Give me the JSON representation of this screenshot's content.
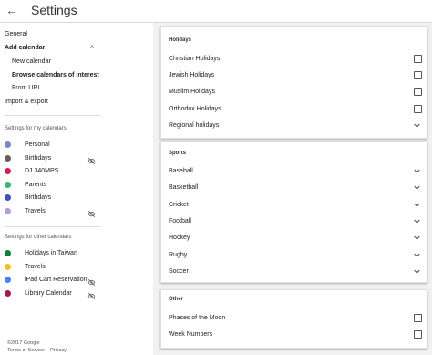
{
  "header": {
    "title": "Settings",
    "back_icon": "arrow-left-icon"
  },
  "sidebar": {
    "general": "General",
    "add_calendar": "Add calendar",
    "new_calendar": "New calendar",
    "browse": "Browse calendars of interest",
    "from_url": "From URL",
    "import_export": "Import & export",
    "my_calendars_label": "Settings for my calendars",
    "my_calendars": [
      {
        "name": "Personal",
        "color": "#7986cb",
        "hidden": false
      },
      {
        "name": "Birthdays",
        "color": "#616161",
        "hidden": true
      },
      {
        "name": "DJ 340MPS",
        "color": "#d81b60",
        "hidden": false
      },
      {
        "name": "Parents",
        "color": "#33b679",
        "hidden": false
      },
      {
        "name": "Birthdays",
        "color": "#3f51b5",
        "hidden": false
      },
      {
        "name": "Travels",
        "color": "#b39ddb",
        "hidden": true
      }
    ],
    "other_calendars_label": "Settings for other calendars",
    "other_calendars": [
      {
        "name": "Holidays in Taiwan",
        "color": "#0b8043",
        "hidden": false
      },
      {
        "name": "Travels",
        "color": "#f6bf26",
        "hidden": false
      },
      {
        "name": "iPad Cart Reservation",
        "color": "#4285f4",
        "hidden": true
      },
      {
        "name": "Library Calendar",
        "color": "#ad1457",
        "hidden": true
      }
    ],
    "copyright": "©2017 Google",
    "terms": "Terms of Service – Privacy"
  },
  "holidays": {
    "title": "Holidays",
    "items": [
      {
        "label": "Christian Holidays",
        "control": "checkbox"
      },
      {
        "label": "Jewish Holidays",
        "control": "checkbox"
      },
      {
        "label": "Muslim Holidays",
        "control": "checkbox"
      },
      {
        "label": "Orthodox Holidays",
        "control": "checkbox"
      },
      {
        "label": "Regional holidays",
        "control": "chevron"
      }
    ]
  },
  "sports": {
    "title": "Sports",
    "items": [
      "Baseball",
      "Basketball",
      "Cricket",
      "Football",
      "Hockey",
      "Rugby",
      "Soccer"
    ]
  },
  "other": {
    "title": "Other",
    "items": [
      "Phases of the Moon",
      "Week Numbers"
    ]
  }
}
